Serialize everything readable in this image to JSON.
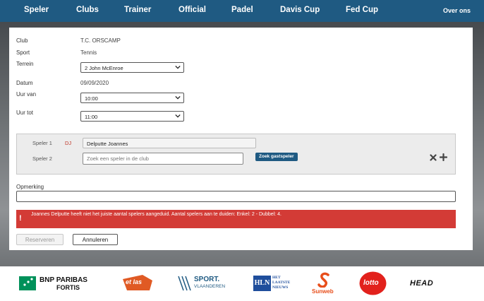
{
  "nav": {
    "items": [
      "Speler",
      "Clubs",
      "Trainer",
      "Official",
      "Padel",
      "Davis Cup",
      "Fed Cup"
    ],
    "about": "Over ons"
  },
  "form": {
    "club_label": "Club",
    "club_value": "T.C. ORSCAMP",
    "sport_label": "Sport",
    "sport_value": "Tennis",
    "terrein_label": "Terrein",
    "terrein_value": "2 John McEnroe",
    "datum_label": "Datum",
    "datum_value": "09/09/2020",
    "uur_van_label": "Uur van",
    "uur_van_value": "10:00",
    "uur_tot_label": "Uur tot",
    "uur_tot_value": "11:00"
  },
  "players": {
    "speler1_label": "Speler 1",
    "speler1_tag": "DJ",
    "speler1_value": "Delputte Joannes",
    "speler2_label": "Speler 2",
    "speler2_placeholder": "Zoek een speler in de club",
    "guest_button": "Zoek gastspeler"
  },
  "remark": {
    "label": "Opmerking",
    "value": ""
  },
  "alert": {
    "message": "Joannes Delputte heeft niet het juiste aantal spelers aangeduid. Aantal spelers aan te duiden: Enkel: 2 - Dubbel: 4."
  },
  "actions": {
    "reserve": "Reserveren",
    "cancel": "Annuleren"
  },
  "sponsors": {
    "bnp_line1": "BNP PARIBAS",
    "bnp_line2": "FORTIS",
    "etlas": "et las",
    "sport_line1": "SPORT.",
    "sport_line2": "VLAANDEREN",
    "hln_mark": "HLN",
    "hln_line1": "HET",
    "hln_line2": "LAATSTE",
    "hln_line3": "NIEUWS",
    "sunweb": "Sunweb",
    "lotto": "lotto",
    "head": "HEAD"
  },
  "colors": {
    "nav_bg": "#1f5a82",
    "alert_bg": "#d33b36",
    "accent_red": "#c0392b"
  }
}
